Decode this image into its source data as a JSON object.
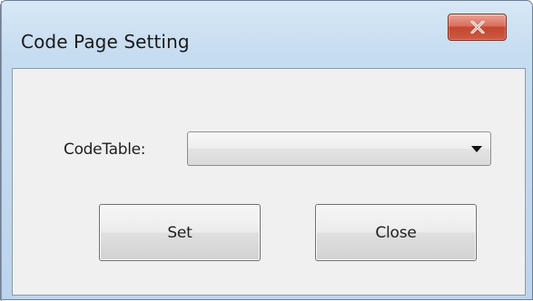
{
  "window": {
    "title": "Code Page Setting",
    "close_icon": "close-icon"
  },
  "form": {
    "code_table_label": "CodeTable:",
    "code_table_value": "",
    "dropdown_icon": "chevron-down-icon"
  },
  "buttons": {
    "set_label": "Set",
    "close_label": "Close"
  },
  "colors": {
    "titlebar": "#c6dcf0",
    "client_background": "#f0f0f0",
    "close_button": "#c44630"
  }
}
